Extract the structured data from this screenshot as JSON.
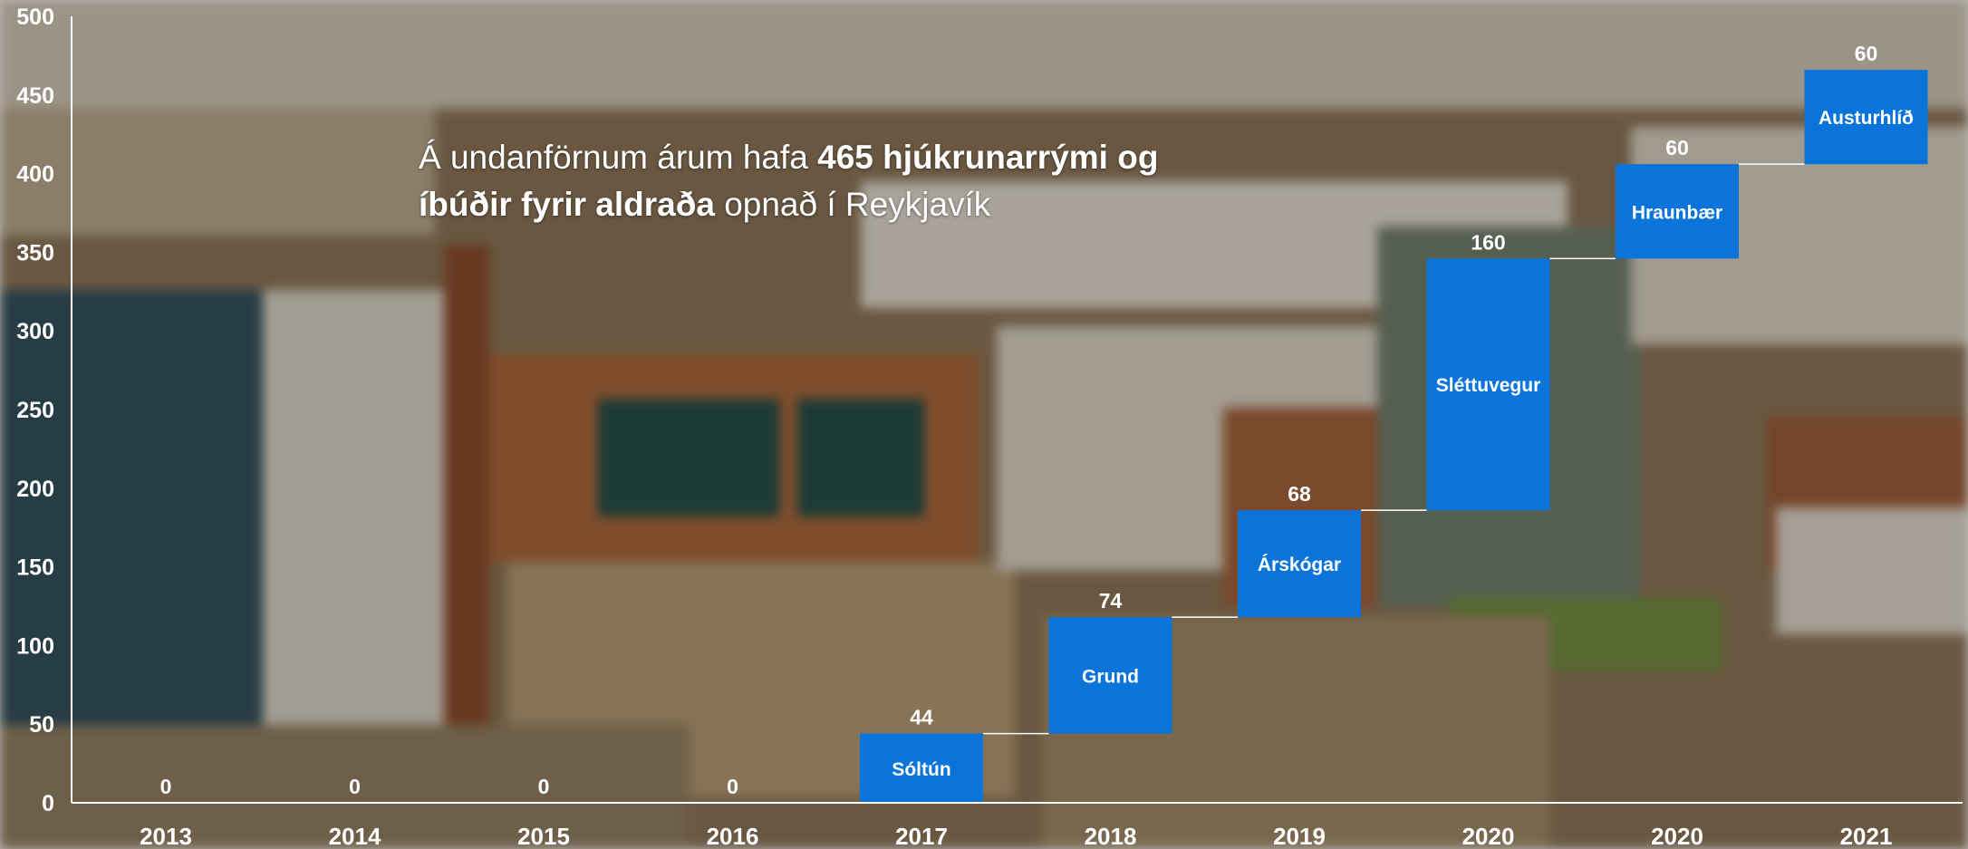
{
  "chart_data": {
    "type": "waterfall",
    "ylim": [
      0,
      500
    ],
    "y_ticks": [
      "0",
      "50",
      "100",
      "150",
      "200",
      "250",
      "300",
      "350",
      "400",
      "450",
      "500"
    ],
    "grid": false,
    "categories": [
      "2013",
      "2014",
      "2015",
      "2016",
      "2017",
      "2018",
      "2019",
      "2020",
      "2020",
      "2021"
    ],
    "values": [
      0,
      0,
      0,
      0,
      44,
      74,
      68,
      160,
      60,
      60
    ],
    "value_labels": [
      "0",
      "0",
      "0",
      "0",
      "44",
      "74",
      "68",
      "160",
      "60",
      "60"
    ],
    "bar_labels": [
      "",
      "",
      "",
      "",
      "Sóltún",
      "Grund",
      "Árskógar",
      "Sléttuvegur",
      "Hraunbær",
      "Austurhlíð"
    ],
    "bar_color": "#0a74da",
    "axis_color": "#ffffff"
  },
  "annotation": {
    "part1": "Á undanförnum árum hafa ",
    "part2": "465 hjúkrunarrými  og",
    "part3": "íbúðir fyrir aldraða",
    "part4": " opnað í Reykjavík"
  }
}
